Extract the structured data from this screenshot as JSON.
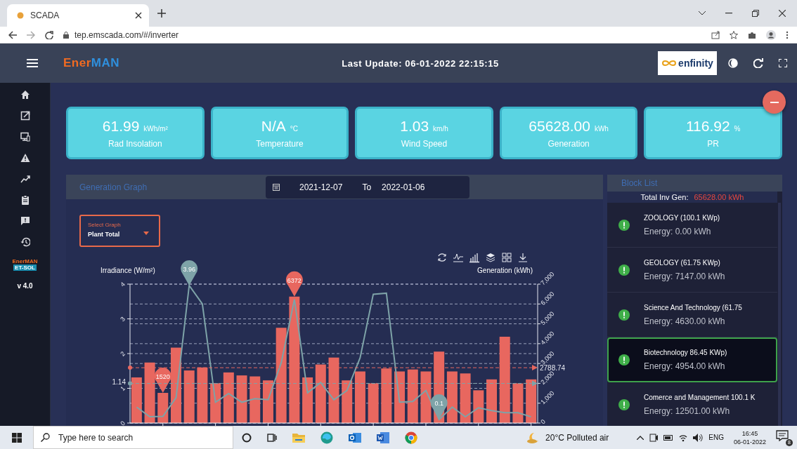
{
  "browser": {
    "tab_title": "SCADA",
    "url": "tep.emscada.com/#/inverter"
  },
  "header": {
    "logo": [
      {
        "text": "Ener",
        "color": "#f26b21"
      },
      {
        "text": "MAN",
        "color": "#2f8fdc"
      }
    ],
    "last_update": "Last Update: 06-01-2022 22:15:15",
    "partner_logo": "enfinity"
  },
  "sidebar": {
    "brand": [
      "EnerMAN",
      "ET-SOL"
    ],
    "version": "v 4.0"
  },
  "kpis": [
    {
      "value": "61.99",
      "unit": "kWh/m²",
      "label": "Rad Insolation"
    },
    {
      "value": "N/A",
      "unit": "°C",
      "label": "Temperature"
    },
    {
      "value": "1.03",
      "unit": "km/h",
      "label": "Wind Speed"
    },
    {
      "value": "65628.00",
      "unit": "kWh",
      "label": "Generation"
    },
    {
      "value": "116.92",
      "unit": "%",
      "label": "PR"
    }
  ],
  "generation_graph": {
    "title": "Generation Graph",
    "date_from": "2021-12-07",
    "to_label": "To",
    "date_to": "2022-01-06",
    "select": {
      "label": "Select Graph",
      "value": "Plant Total"
    },
    "chart_data": {
      "type": "bar",
      "ylabel": "Irradiance (W/m²)",
      "y2label": "Generation (kWh)",
      "ylim": [
        0,
        4
      ],
      "y2lim": [
        0,
        7000
      ],
      "yticks": [
        0,
        1,
        2,
        3,
        4
      ],
      "y2ticks": [
        0,
        {
          "value": 1000,
          "label": "1,000"
        },
        {
          "value": 2000,
          "label": "2,000"
        },
        {
          "value": 3000,
          "label": "3,000"
        },
        {
          "value": 4000,
          "label": "4,000"
        },
        {
          "value": 5000,
          "label": "5,000"
        },
        {
          "value": 6000,
          "label": "6,000"
        },
        {
          "value": 7000,
          "label": "7,000"
        }
      ],
      "grid": true,
      "series": [
        {
          "color": "#e8675f",
          "axis": "y2",
          "values": [
            2300,
            3050,
            1520,
            3800,
            2650,
            2800,
            2000,
            2550,
            2400,
            2350,
            2150,
            4800,
            6372,
            2300,
            2950,
            3300,
            2150,
            2600,
            2000,
            2750,
            2600,
            2700,
            2600,
            3600,
            2600,
            2500,
            1650,
            2200,
            4350,
            2000,
            2200
          ]
        },
        {
          "color": "#7ea3a8",
          "type": "line",
          "values": [
            0.46,
            0.18,
            0.19,
            0.73,
            3.96,
            3.43,
            0.6,
            0.85,
            0.6,
            0.7,
            0.67,
            1.74,
            3.56,
            0.87,
            1.17,
            0.67,
            0.94,
            1.88,
            3.71,
            3.74,
            0.6,
            0.62,
            0.94,
            0.1,
            0.46,
            0.18,
            0.44,
            0.36,
            0.3,
            0.3,
            0.18
          ]
        }
      ],
      "annotations": [
        "3.96",
        "6372",
        "1520",
        "0.1"
      ],
      "ref_lines": [
        {
          "value": 2788.74,
          "label": "2788.74",
          "axis": "y2",
          "color": "#e8675f"
        },
        {
          "value": 1.14,
          "label": "1.14",
          "axis": "y",
          "color": "#7ea3a8"
        }
      ]
    }
  },
  "block_list": {
    "title": "Block List",
    "total_label": "Total Inv Gen:",
    "total_value": "65628.00 kWh",
    "items": [
      {
        "name": "ZOOLOGY (100.1 KWp)",
        "energy": "Energy: 0.00 kWh",
        "selected": false
      },
      {
        "name": "GEOLOGY (61.75 KWp)",
        "energy": "Energy: 7147.00 kWh",
        "selected": false
      },
      {
        "name": "Science And Technology (61.75",
        "energy": "Energy: 4630.00 kWh",
        "selected": false
      },
      {
        "name": "Biotechnology 86.45 KWp)",
        "energy": "Energy: 4954.00 kWh",
        "selected": true
      },
      {
        "name": "Comerce and Management 100.1 K",
        "energy": "Energy: 12501.00 kWh",
        "selected": false
      }
    ]
  },
  "taskbar": {
    "search_placeholder": "Type here to search",
    "weather": "20°C Polluted air",
    "language": "ENG",
    "time": "16:45",
    "date": "06-01-2022",
    "notifications": "8"
  }
}
